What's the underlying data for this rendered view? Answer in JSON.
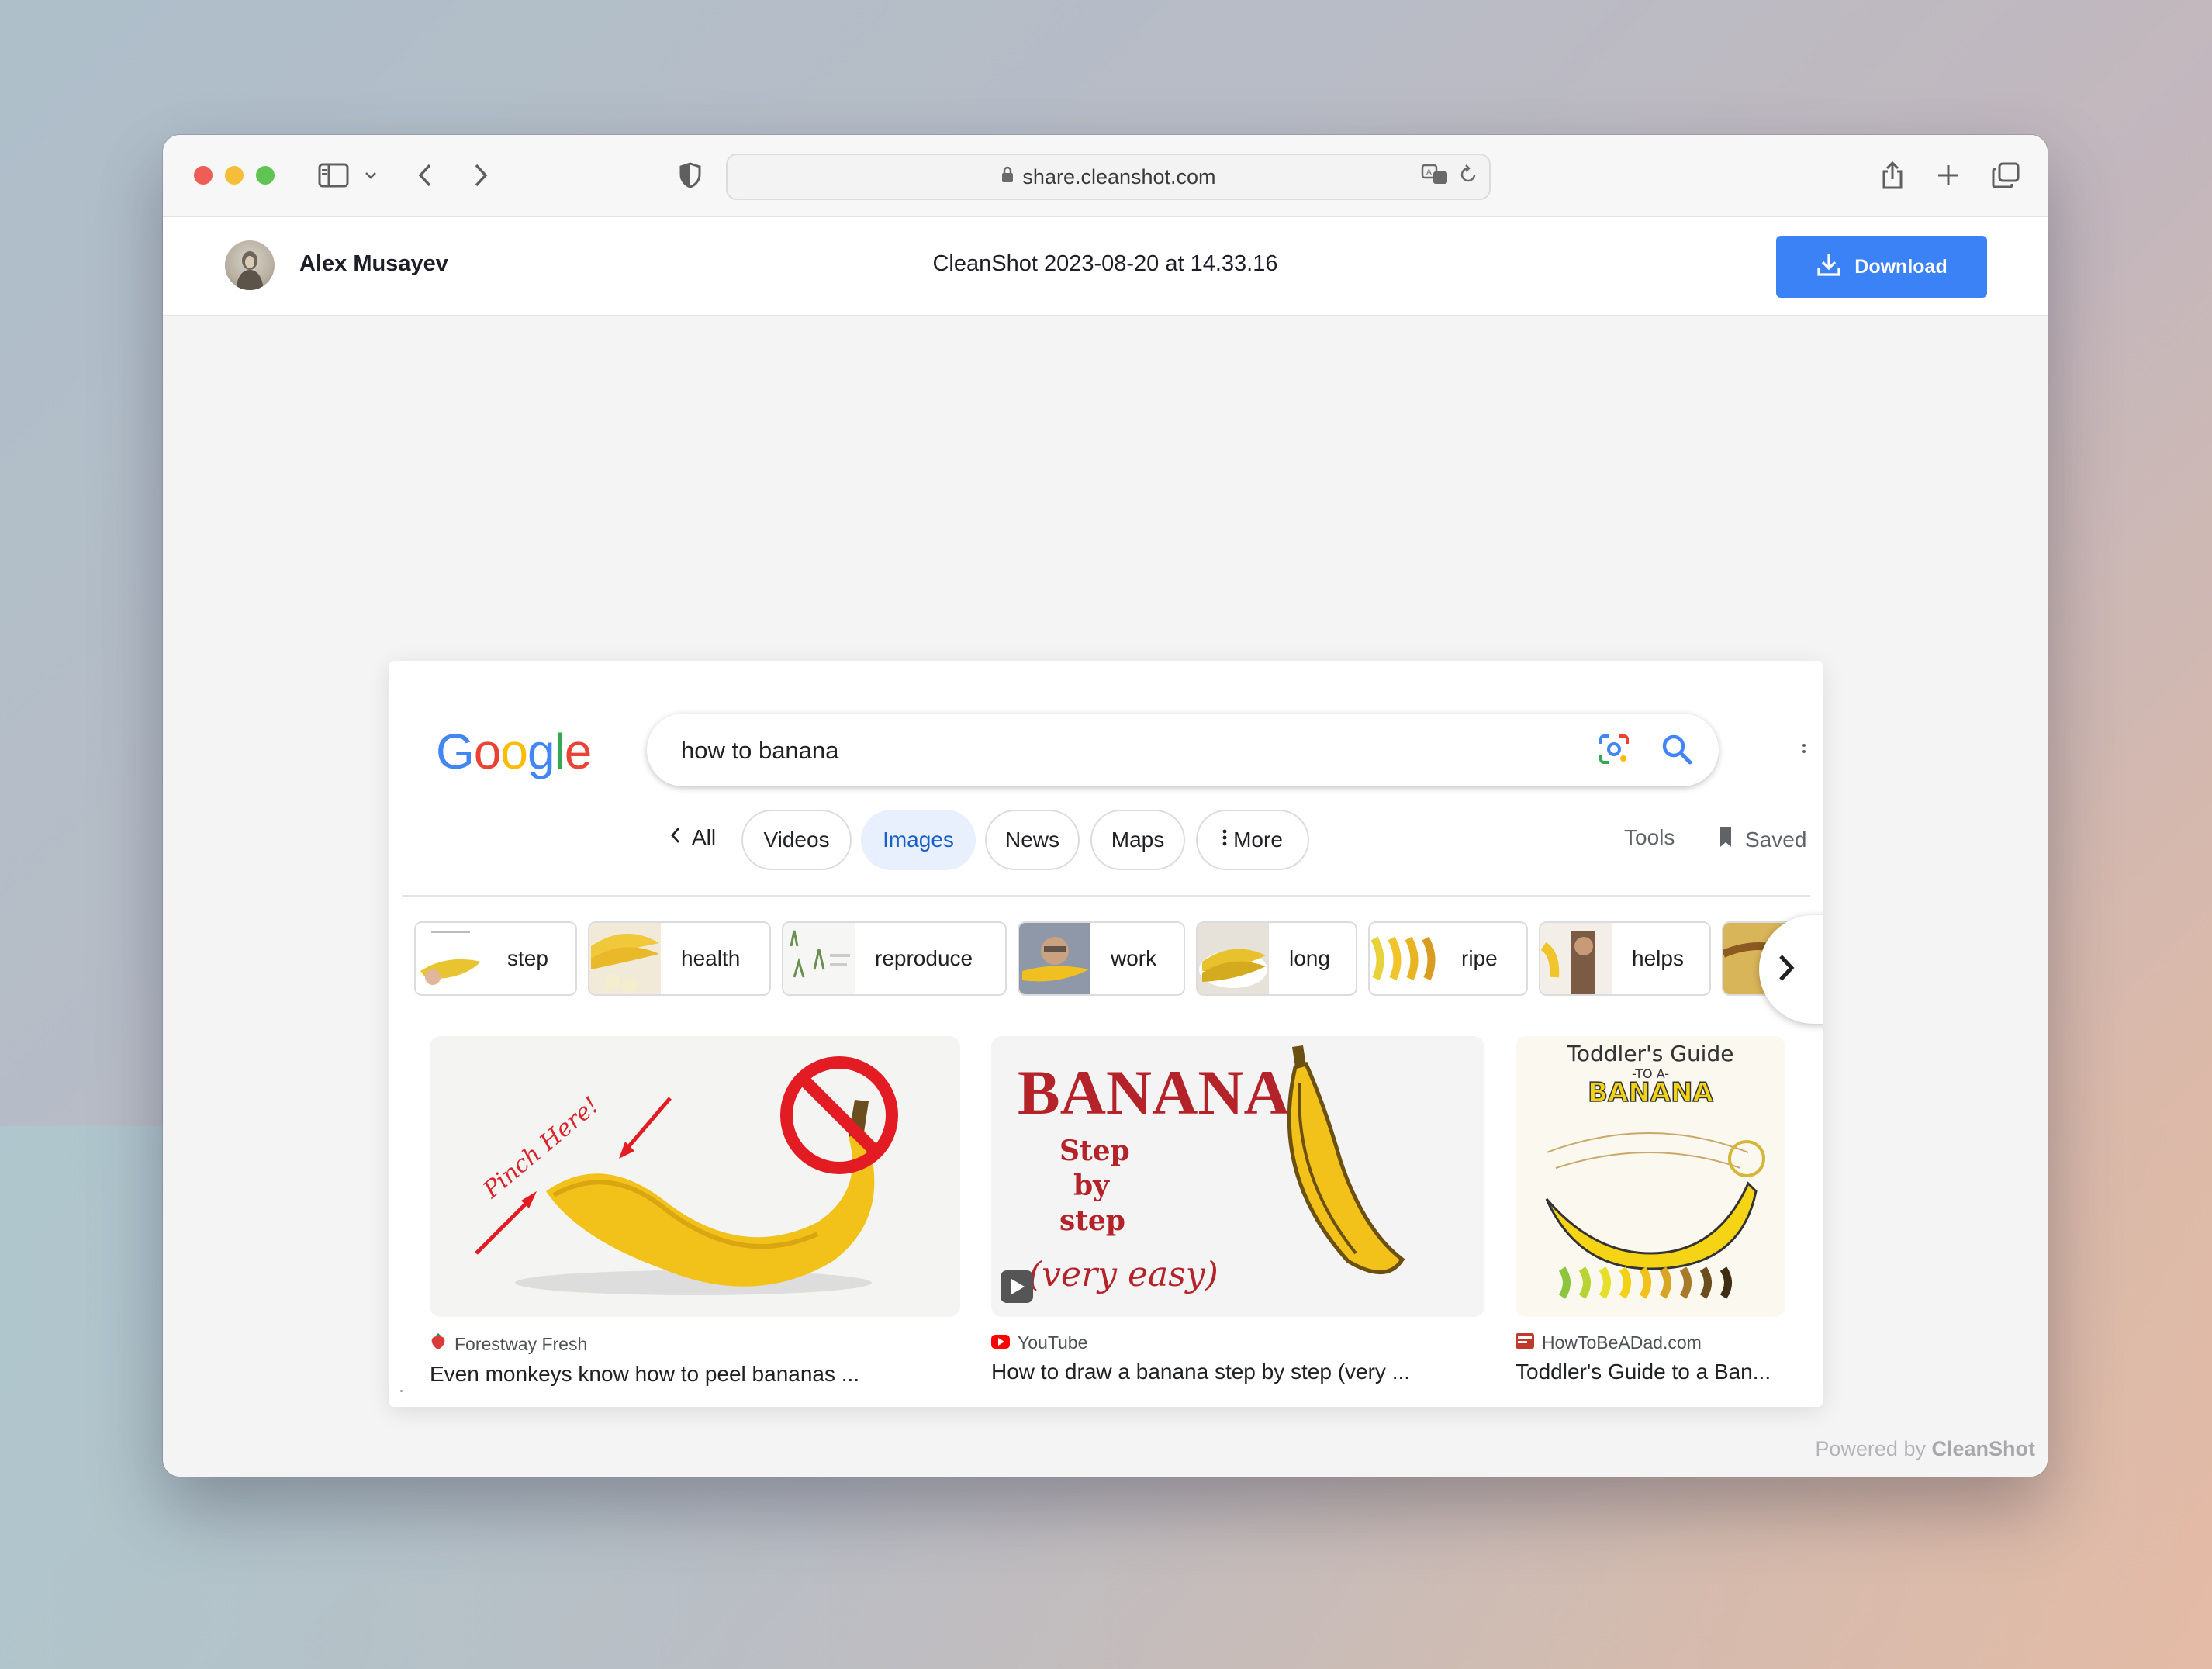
{
  "browser": {
    "url": "share.cleanshot.com"
  },
  "app": {
    "user_name": "Alex Musayev",
    "file_title": "CleanShot 2023-08-20 at 14.33.16",
    "download_label": "Download",
    "powered_prefix": "Powered by",
    "powered_brand": "CleanShot"
  },
  "google": {
    "logo": [
      "G",
      "o",
      "o",
      "g",
      "l",
      "e"
    ],
    "logo_colors": [
      "#4285f4",
      "#ea4335",
      "#fbbc05",
      "#4285f4",
      "#34a853",
      "#ea4335"
    ],
    "query": "how to banana",
    "tabs": {
      "all": "All",
      "chips": [
        "Videos",
        "Images",
        "News",
        "Maps",
        "More"
      ],
      "active": "Images",
      "tools": "Tools",
      "saved": "Saved"
    },
    "refinements": [
      "step",
      "health",
      "reproduce",
      "work",
      "long",
      "ripe",
      "helps"
    ],
    "results": [
      {
        "source": "Forestway Fresh",
        "title": "Even monkeys know how to peel bananas ...",
        "img_text": "Pinch Here!"
      },
      {
        "source": "YouTube",
        "title": "How to draw a banana step by step (very ...",
        "img_title": "BANANA",
        "img_lines": [
          "Step",
          "by",
          "step"
        ],
        "img_note": "(very easy)"
      },
      {
        "source": "HowToBeADad.com",
        "title": "Toddler's Guide to a Ban...",
        "img_title": "Toddler's Guide",
        "img_sub": "-TO A-",
        "img_word": "BANANA"
      }
    ]
  },
  "colors": {
    "accent": "#3b82f6",
    "google_active": "#1a5fc8",
    "banana": "#f2c21b"
  }
}
